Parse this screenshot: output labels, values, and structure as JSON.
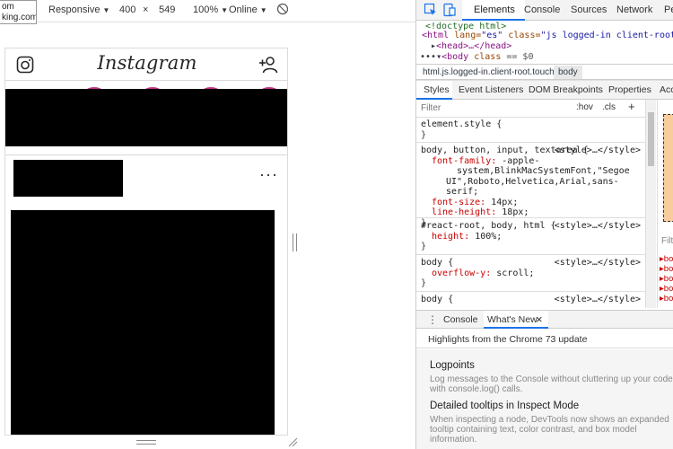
{
  "url_tooltip": {
    "line1": "om",
    "line2": "king.com"
  },
  "device_toolbar": {
    "device": "Responsive",
    "width": "400",
    "times": "×",
    "height": "549",
    "zoom": "100%",
    "network": "Online"
  },
  "instagram": {
    "logo": "Instagram",
    "more": "···"
  },
  "devtools": {
    "tabs": [
      "Elements",
      "Console",
      "Sources",
      "Network",
      "Pe"
    ],
    "dom": {
      "doctype": "<!doctype html>",
      "html_open": "<html",
      "html_attr1": "lang=",
      "html_val1": "\"es\"",
      "html_attr2": "class=",
      "html_val2": "\"js logged-in client-root touch",
      "head": "<head>…</head>",
      "body_open": "<body",
      "body_attr": "class",
      "body_eq": "== $0"
    },
    "breadcrumb": [
      "html.js.logged-in.client-root.touch",
      "body"
    ],
    "styles_tabs": [
      "Styles",
      "Event Listeners",
      "DOM Breakpoints",
      "Properties",
      "Acc"
    ],
    "filter_placeholder": "Filter",
    "hov": ":hov",
    "cls": ".cls",
    "plus": "+",
    "rules": {
      "r1_selector": "element.style {",
      "r1_close": "}",
      "r2_selector": "body, button, input, textarea {",
      "r2_source": "<style>…</style>",
      "r2_p1_name": "font-family:",
      "r2_p1_val1": "-apple-",
      "r2_p1_val2": "system,BlinkMacSystemFont,\"Segoe",
      "r2_p1_val3": "UI\",Roboto,Helvetica,Arial,sans-serif;",
      "r2_p2_name": "font-size:",
      "r2_p2_val": "14px;",
      "r2_p3_name": "line-height:",
      "r2_p3_val": "18px;",
      "r2_close": "}",
      "r3_selector": "#react-root, body, html {",
      "r3_source": "<style>…</style>",
      "r3_p1_name": "height:",
      "r3_p1_val": "100%;",
      "r3_close": "}",
      "r4_selector": "body {",
      "r4_source": "<style>…</style>",
      "r4_p1_name": "overflow-y:",
      "r4_p1_val": "scroll;",
      "r4_close": "}",
      "r5_selector": "body {",
      "r5_source": "<style>…</style>"
    },
    "side_pane": {
      "filter": "Filt",
      "items": [
        "bo",
        "bo",
        "bo",
        "bo",
        "bo"
      ]
    },
    "drawer": {
      "tabs": [
        "Console",
        "What's New"
      ],
      "close": "×",
      "highlights": "Highlights from the Chrome 73 update",
      "items": [
        {
          "title": "Logpoints",
          "desc": "Log messages to the Console without cluttering up your code with console.log() calls."
        },
        {
          "title": "Detailed tooltips in Inspect Mode",
          "desc": "When inspecting a node, DevTools now shows an expanded tooltip containing text, color contrast, and box model information."
        }
      ]
    }
  }
}
